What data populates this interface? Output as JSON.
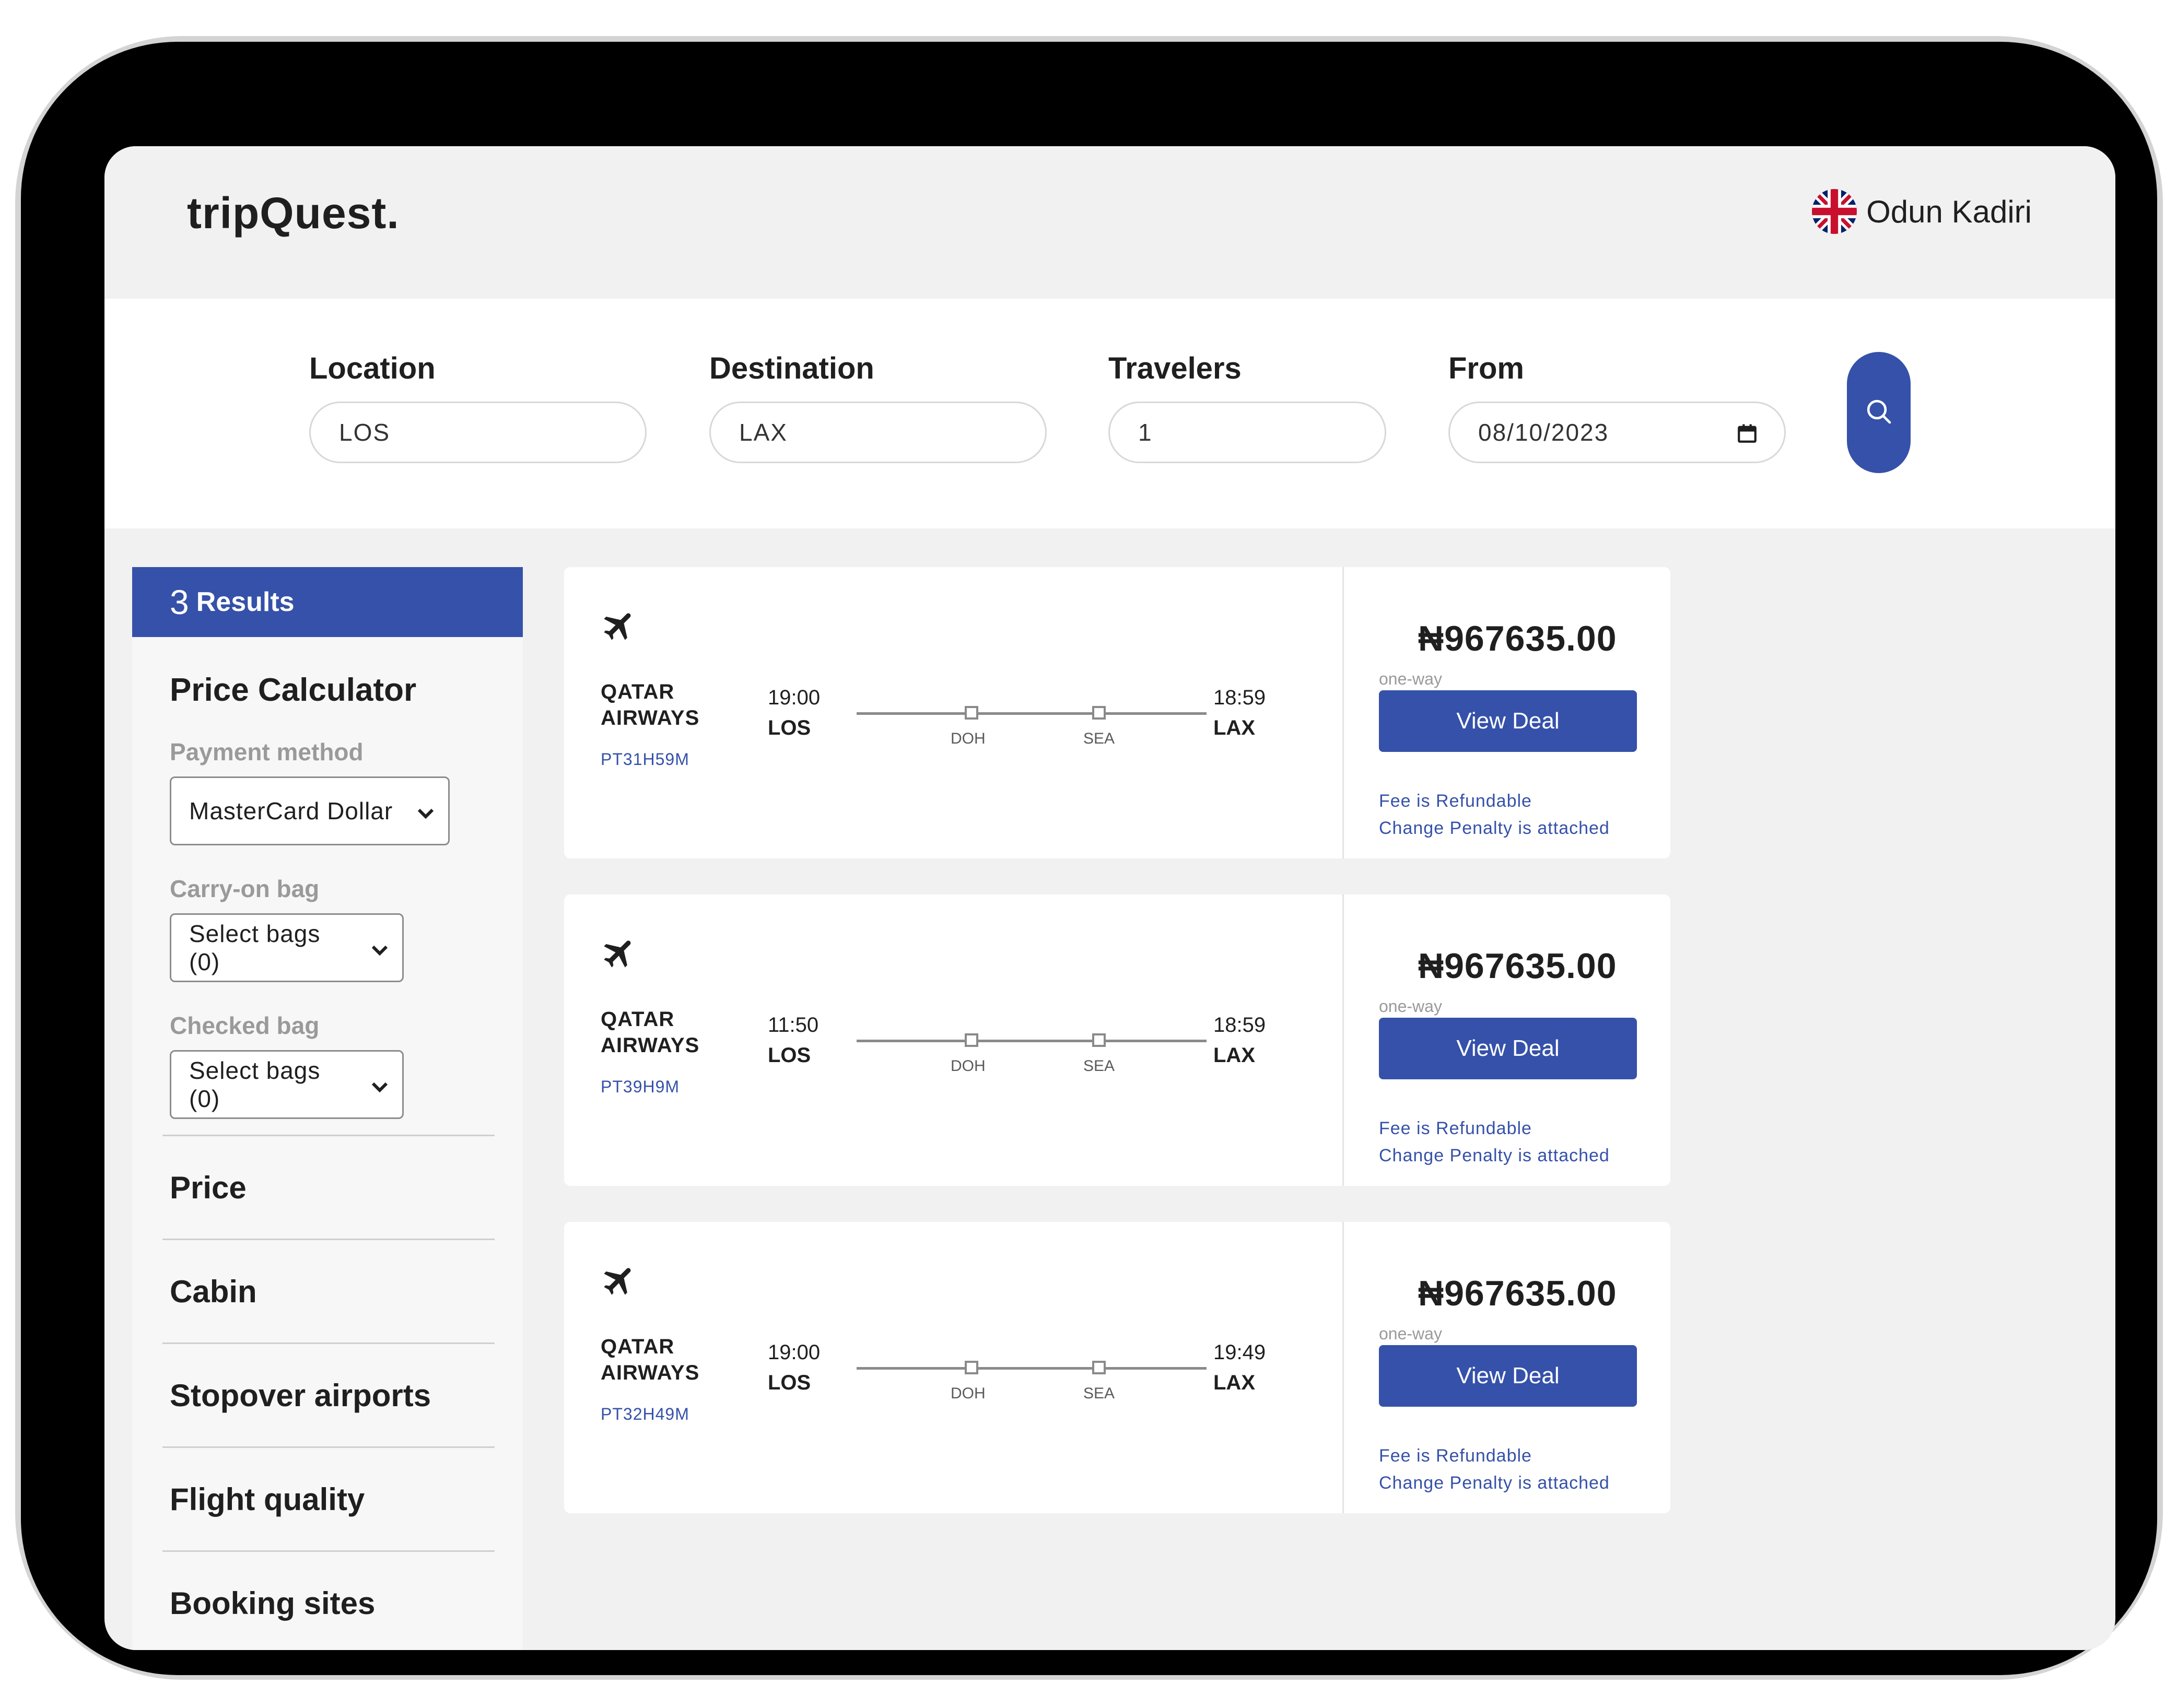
{
  "header": {
    "logo": "tripQuest.",
    "user_name": "Odun Kadiri",
    "flag_icon": "uk-flag-icon"
  },
  "search": {
    "location_label": "Location",
    "location_value": "LOS",
    "destination_label": "Destination",
    "destination_value": "LAX",
    "travelers_label": "Travelers",
    "travelers_value": "1",
    "from_label": "From",
    "from_value": "08/10/2023",
    "search_icon": "search-icon"
  },
  "sidebar": {
    "results_count": "3",
    "results_label": "Results",
    "calculator_title": "Price Calculator",
    "payment_label": "Payment method",
    "payment_value": "MasterCard Dollar",
    "carry_label": "Carry-on bag",
    "carry_value": "Select bags (0)",
    "checked_label": "Checked bag",
    "checked_value": "Select bags (0)",
    "filters": [
      "Price",
      "Cabin",
      "Stopover airports",
      "Flight quality",
      "Booking sites"
    ]
  },
  "flights": [
    {
      "airline_line1": "QATAR",
      "airline_line2": "AIRWAYS",
      "code": "PT31H59M",
      "dep_time": "19:00",
      "dep_airport": "LOS",
      "arr_time": "18:59",
      "arr_airport": "LAX",
      "stops": [
        "DOH",
        "SEA"
      ],
      "price": "₦967635.00",
      "trip_type": "one-way",
      "button": "View Deal",
      "fee_note": "Fee is Refundable",
      "penalty_note": "Change Penalty is attached"
    },
    {
      "airline_line1": "QATAR",
      "airline_line2": "AIRWAYS",
      "code": "PT39H9M",
      "dep_time": "11:50",
      "dep_airport": "LOS",
      "arr_time": "18:59",
      "arr_airport": "LAX",
      "stops": [
        "DOH",
        "SEA"
      ],
      "price": "₦967635.00",
      "trip_type": "one-way",
      "button": "View Deal",
      "fee_note": "Fee is Refundable",
      "penalty_note": "Change Penalty is attached"
    },
    {
      "airline_line1": "QATAR",
      "airline_line2": "AIRWAYS",
      "code": "PT32H49M",
      "dep_time": "19:00",
      "dep_airport": "LOS",
      "arr_time": "19:49",
      "arr_airport": "LAX",
      "stops": [
        "DOH",
        "SEA"
      ],
      "price": "₦967635.00",
      "trip_type": "one-way",
      "button": "View Deal",
      "fee_note": "Fee is Refundable",
      "penalty_note": "Change Penalty is attached"
    }
  ],
  "colors": {
    "accent": "#3551a9",
    "background": "#f1f1f1",
    "frame": "#000000"
  }
}
